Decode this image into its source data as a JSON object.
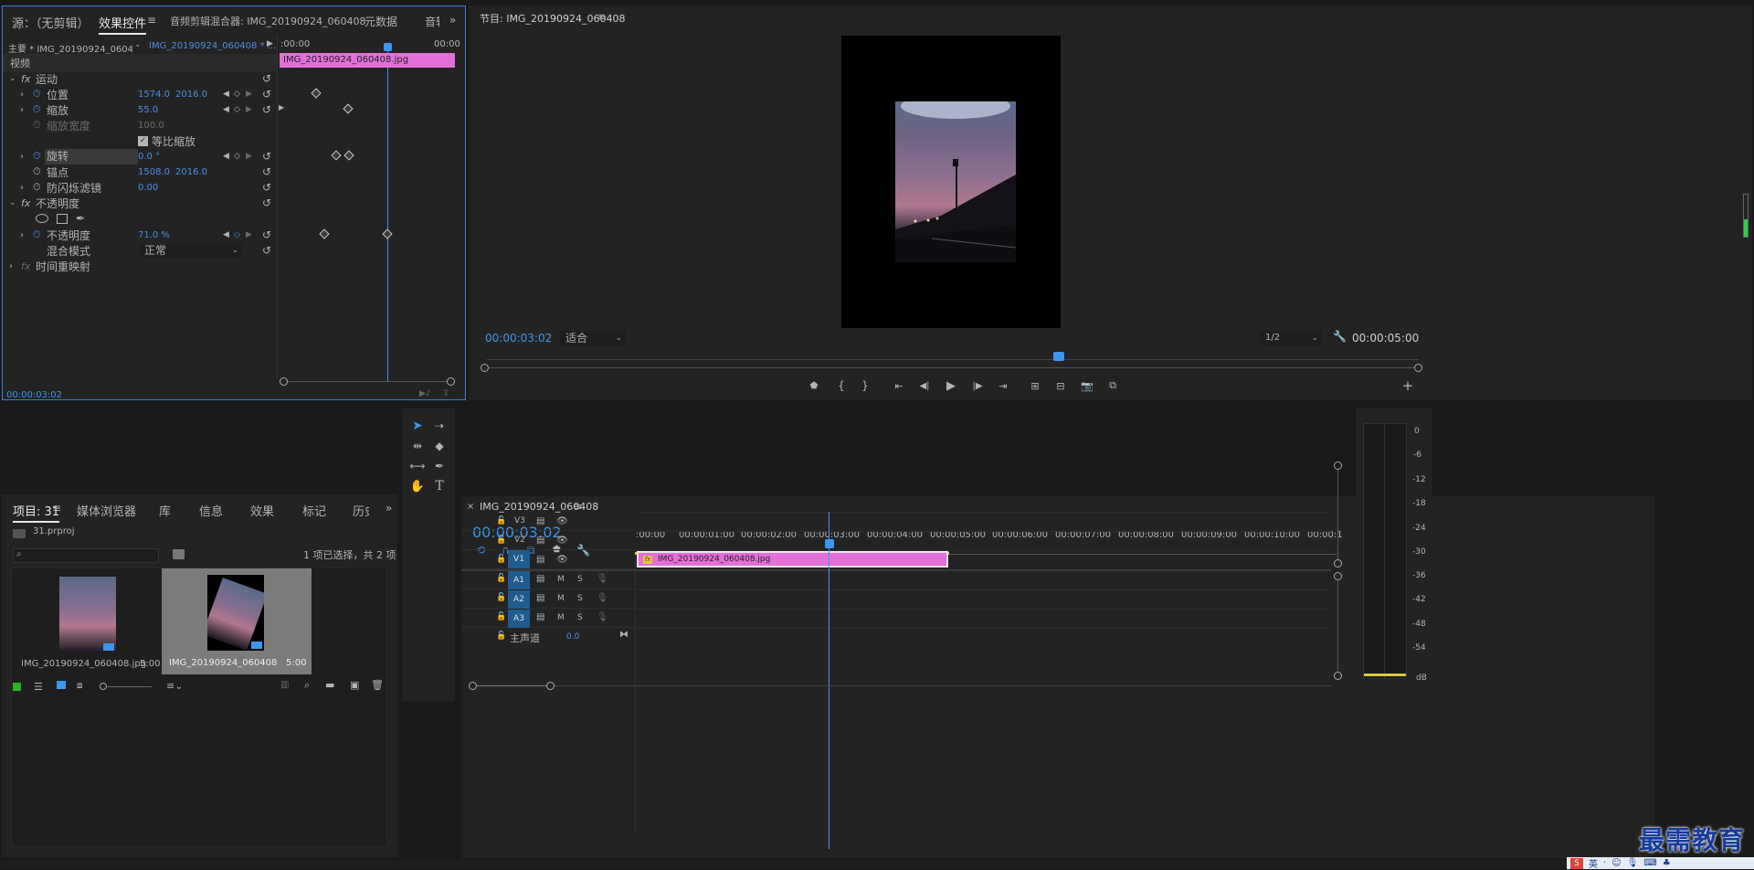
{
  "source_panel": {
    "tabs": [
      "源：（无剪辑）",
      "效果控件",
      "音频剪辑混合器: IMG_20190924_060408",
      "元数据",
      "音轨"
    ],
    "master_clip": "主要 * IMG_20190924_060408...",
    "seq_clip": "IMG_20190924_060408 * ...",
    "time_start": ":00:00",
    "time_end": "00:00",
    "clip_label": "IMG_20190924_060408.jpg",
    "section_video": "视频",
    "motion": "运动",
    "props": {
      "position": {
        "name": "位置",
        "v1": "1574.0",
        "v2": "2016.0"
      },
      "scale": {
        "name": "缩放",
        "v1": "55.0"
      },
      "scale_width": {
        "name": "缩放宽度",
        "v1": "100.0"
      },
      "uniform": {
        "name": "等比缩放"
      },
      "rotation": {
        "name": "旋转",
        "v1": "0.0 °"
      },
      "anchor": {
        "name": "锚点",
        "v1": "1508.0",
        "v2": "2016.0"
      },
      "antiflicker": {
        "name": "防闪烁滤镜",
        "v1": "0.00"
      }
    },
    "opacity_section": "不透明度",
    "opacity": {
      "name": "不透明度",
      "v1": "71.0 %"
    },
    "blend": {
      "name": "混合模式",
      "value": "正常"
    },
    "time_remap": "时间重映射",
    "timecode": "00:00:03:02"
  },
  "program": {
    "title": "节目: IMG_20190924_060408",
    "timecode_left": "00:00:03:02",
    "fit": "适合",
    "resolution": "1/2",
    "timecode_right": "00:00:05:00"
  },
  "project": {
    "tabs": [
      "项目: 31",
      "媒体浏览器",
      "库",
      "信息",
      "效果",
      "标记",
      "历史"
    ],
    "file": "31.prproj",
    "selection": "1 项已选择，共 2 项",
    "items": [
      {
        "name": "IMG_20190924_060408.jpg",
        "dur": "5:00"
      },
      {
        "name": "IMG_20190924_060408",
        "dur": "5:00"
      }
    ]
  },
  "timeline": {
    "tab": "IMG_20190924_060408",
    "timecode": "00:00:03:02",
    "ruler": [
      ":00:00",
      "00:00:01:00",
      "00:00:02:00",
      "00:00:03:00",
      "00:00:04:00",
      "00:00:05:00",
      "00:00:06:00",
      "00:00:07:00",
      "00:00:08:00",
      "00:00:09:00",
      "00:00:10:00",
      "00:00:1"
    ],
    "tracks_video": [
      "V3",
      "V2",
      "V1"
    ],
    "tracks_audio": [
      "A1",
      "A2",
      "A3"
    ],
    "master": "主声道",
    "master_val": "0.0",
    "clip": "IMG_20190924_060408.jpg",
    "m": "M",
    "s": "S"
  },
  "meter": {
    "labels": [
      "0",
      "-6",
      "-12",
      "-18",
      "-24",
      "-30",
      "-36",
      "-42",
      "-48",
      "-54",
      "dB"
    ]
  },
  "watermark": "最需教育",
  "taskbar": {
    "ime": "英"
  }
}
